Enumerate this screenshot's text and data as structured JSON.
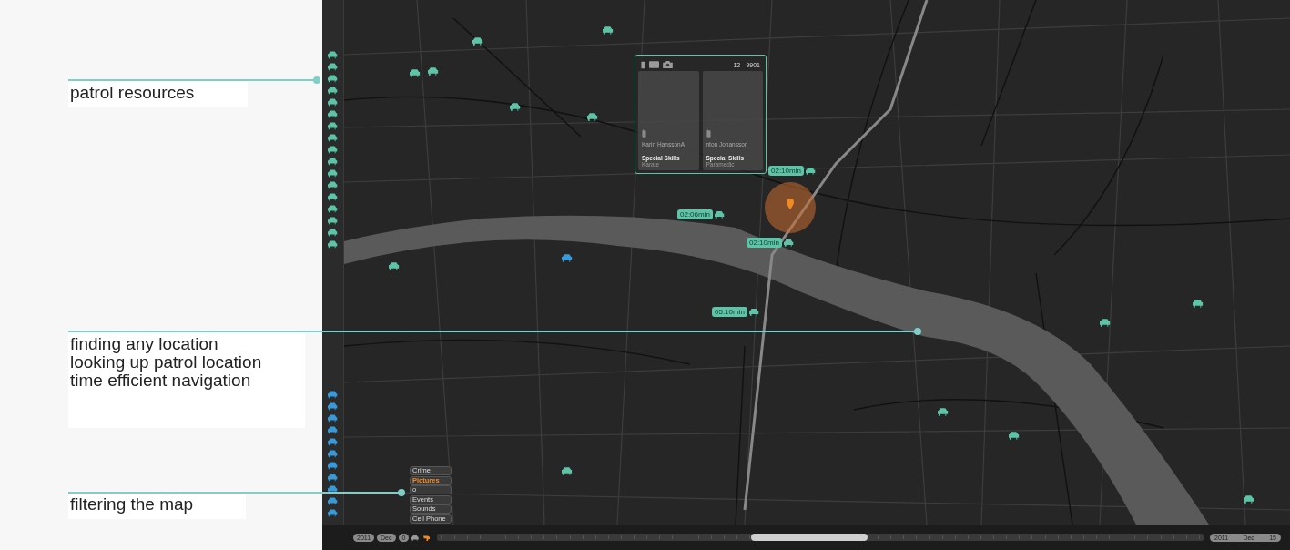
{
  "annotations": [
    {
      "lines": [
        "patrol resources"
      ]
    },
    {
      "lines": [
        "finding any location",
        "looking up patrol location",
        "time efficient navigation"
      ]
    },
    {
      "lines": [
        "filtering the map"
      ]
    }
  ],
  "sidebar": {
    "resources": [
      {
        "color": "#5ec4a8"
      },
      {
        "color": "#5ec4a8"
      },
      {
        "color": "#5ec4a8"
      },
      {
        "color": "#5ec4a8"
      },
      {
        "color": "#5ec4a8"
      },
      {
        "color": "#5ec4a8"
      },
      {
        "color": "#5ec4a8"
      },
      {
        "color": "#5ec4a8"
      },
      {
        "color": "#5ec4a8"
      },
      {
        "color": "#5ec4a8"
      },
      {
        "color": "#5ec4a8"
      },
      {
        "color": "#5ec4a8"
      },
      {
        "color": "#5ec4a8"
      },
      {
        "color": "#5ec4a8"
      },
      {
        "color": "#5ec4a8"
      },
      {
        "color": "#5ec4a8"
      },
      {
        "color": "#5ec4a8"
      }
    ],
    "units": [
      {
        "color": "#3a9ad9"
      },
      {
        "color": "#3a9ad9"
      },
      {
        "color": "#3a9ad9"
      },
      {
        "color": "#3a9ad9"
      },
      {
        "color": "#3a9ad9"
      },
      {
        "color": "#3a9ad9"
      },
      {
        "color": "#3a9ad9"
      },
      {
        "color": "#3a9ad9"
      },
      {
        "color": "#3a9ad9"
      },
      {
        "color": "#3a9ad9"
      },
      {
        "color": "#3a9ad9"
      }
    ]
  },
  "map": {
    "vehicles": [
      {
        "color": "#5ec4a8"
      },
      {
        "color": "#5ec4a8"
      },
      {
        "color": "#5ec4a8"
      },
      {
        "color": "#5ec4a8"
      },
      {
        "color": "#5ec4a8"
      },
      {
        "color": "#5ec4a8"
      },
      {
        "color": "#5ec4a8"
      },
      {
        "color": "#5ec4a8"
      },
      {
        "color": "#5ec4a8"
      },
      {
        "color": "#5ec4a8"
      },
      {
        "color": "#5ec4a8"
      },
      {
        "color": "#5ec4a8"
      },
      {
        "color": "#5ec4a8"
      },
      {
        "color": "#3a9ad9"
      }
    ],
    "eta_labels": [
      "02:10min",
      "02:06min",
      "02:10min",
      "05:10min"
    ],
    "popup": {
      "unit_id": "12 - 9901",
      "officers": [
        {
          "name": "Karin HanssonA",
          "skills_label": "Special Skills",
          "skill": "Karate"
        },
        {
          "name": "nton Johansson",
          "skills_label": "Special Skills",
          "skill": "Paramedic"
        }
      ]
    },
    "filters": [
      {
        "label": "Crime",
        "selected": false
      },
      {
        "label": "Pictures",
        "selected": true
      },
      {
        "label": "o",
        "selected": false
      },
      {
        "label": "Events",
        "selected": false
      },
      {
        "label": "Sounds",
        "selected": false
      },
      {
        "label": "Cell Phone",
        "selected": false
      }
    ]
  },
  "timeline": {
    "start": [
      "2011",
      "Dec",
      "0"
    ],
    "end": [
      "2011",
      "Dec",
      "15"
    ]
  }
}
